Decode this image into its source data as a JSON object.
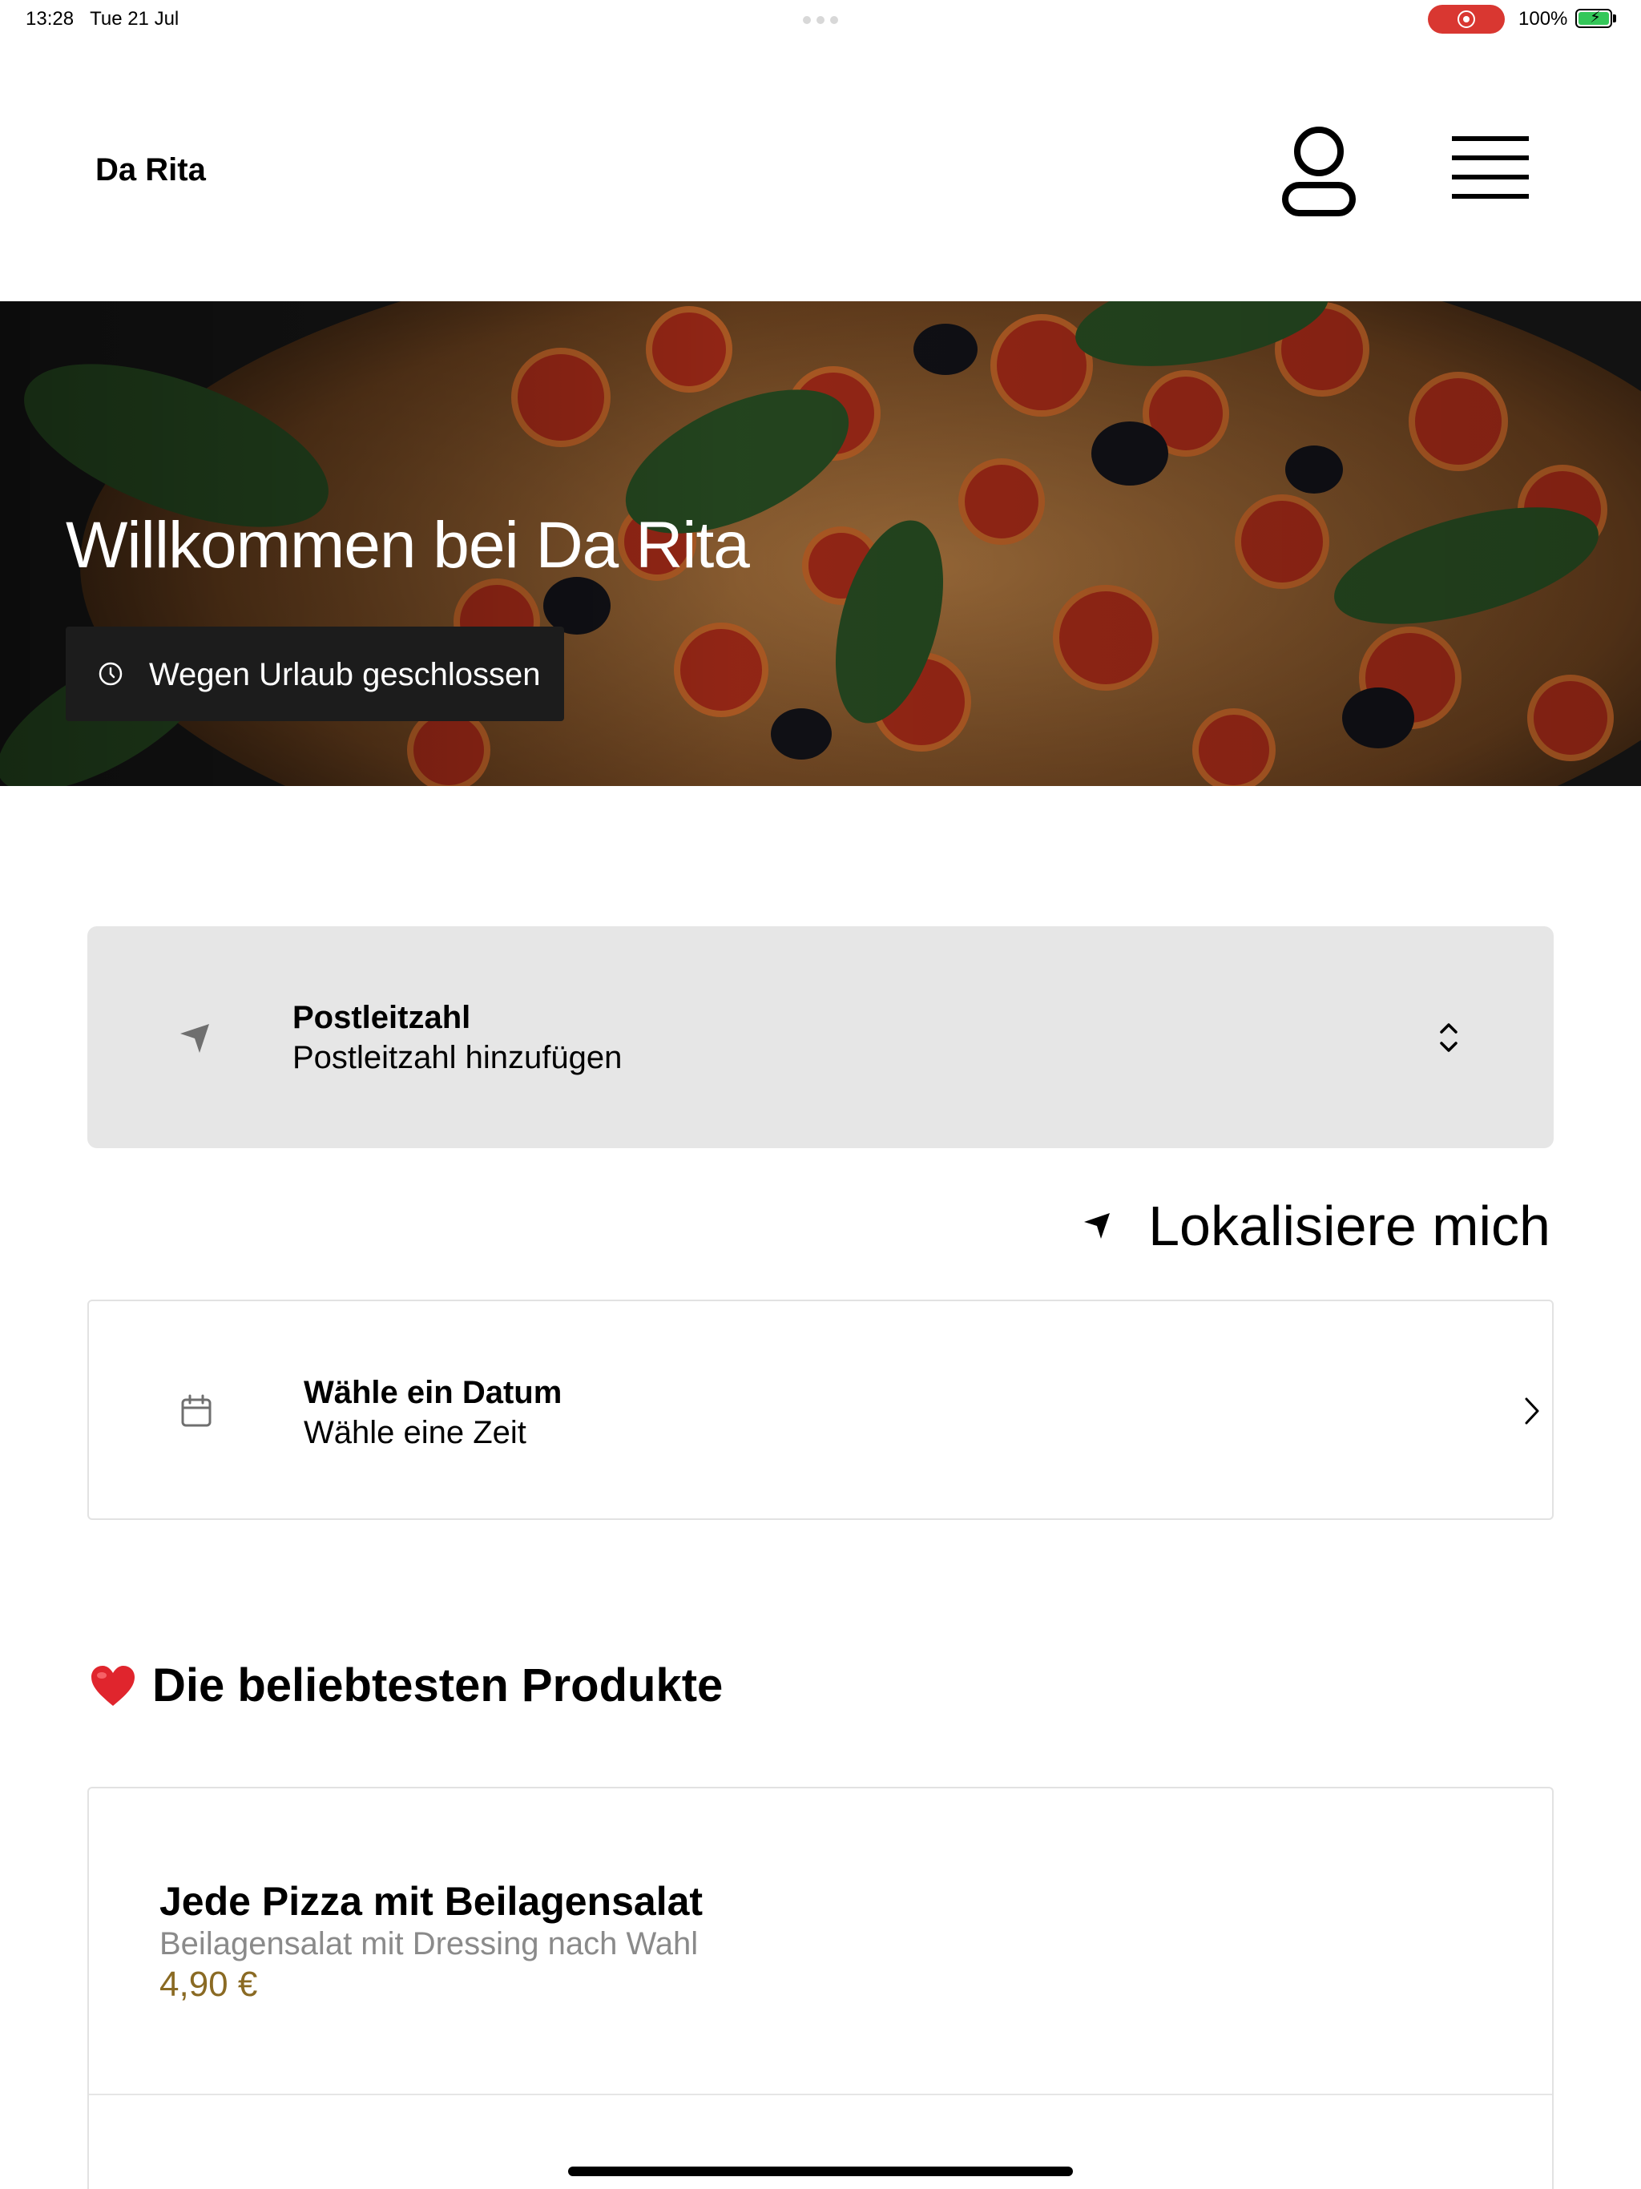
{
  "status_bar": {
    "time": "13:28",
    "date": "Tue 21 Jul",
    "battery": "100%",
    "record_color": "#d93731",
    "battery_color": "#34c759"
  },
  "header": {
    "brand": "Da Rita",
    "profile_icon": "user-icon",
    "menu_icon": "hamburger-menu-icon"
  },
  "hero": {
    "title": "Willkommen bei Da Rita",
    "status_icon": "clock-icon",
    "status_text": "Wegen Urlaub geschlossen"
  },
  "postcode": {
    "icon": "location-arrow-icon",
    "title": "Postleitzahl",
    "subtitle": "Postleitzahl hinzufügen",
    "chevron_icon": "chevron-up-down-icon"
  },
  "locate": {
    "icon": "location-arrow-icon",
    "label": "Lokalisiere mich"
  },
  "date_picker": {
    "icon": "calendar-icon",
    "title": "Wähle ein Datum",
    "subtitle": "Wähle eine Zeit",
    "chevron_icon": "chevron-right-icon"
  },
  "popular": {
    "icon": "heart-icon",
    "title": "Die beliebtesten Produkte",
    "products": [
      {
        "name": "Jede Pizza mit Beilagensalat",
        "description": "Beilagensalat mit Dressing nach Wahl",
        "price": "4,90 €"
      }
    ]
  },
  "colors": {
    "accent_price": "#8a6a23",
    "card_background": "#e6e6e6"
  }
}
